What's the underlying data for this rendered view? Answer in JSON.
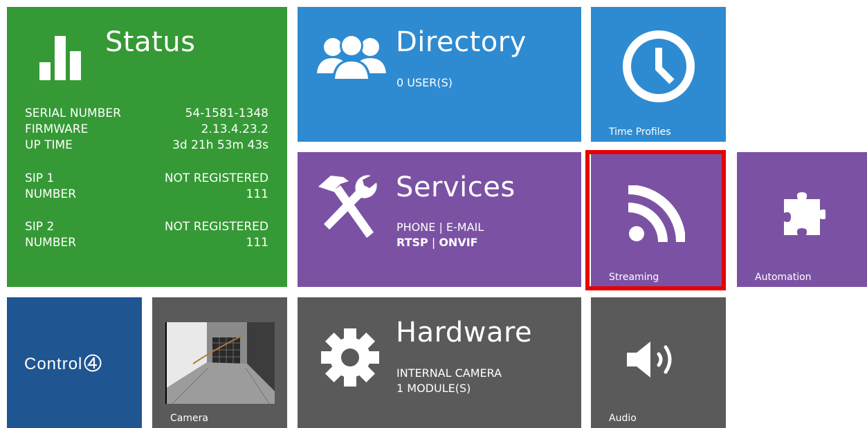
{
  "status": {
    "title": "Status",
    "rows1": [
      {
        "label": "SERIAL NUMBER",
        "value": "54-1581-1348"
      },
      {
        "label": "FIRMWARE",
        "value": "2.13.4.23.2"
      },
      {
        "label": "UP TIME",
        "value": "3d 21h 53m 43s"
      }
    ],
    "sip1": {
      "label1": "SIP 1",
      "value1": "NOT REGISTERED",
      "label2": "NUMBER",
      "value2": "111"
    },
    "sip2": {
      "label1": "SIP 2",
      "value1": "NOT REGISTERED",
      "label2": "NUMBER",
      "value2": "111"
    },
    "icon": "bar-chart-icon",
    "color": "#359a35"
  },
  "directory": {
    "title": "Directory",
    "subtitle": "0 USER(S)",
    "icon": "users-icon",
    "color": "#2e8bd1"
  },
  "time_profiles": {
    "label": "Time Profiles",
    "icon": "clock-icon"
  },
  "services": {
    "title": "Services",
    "line1": "PHONE | E-MAIL",
    "rtsp": "RTSP",
    "sep": " | ",
    "onvif": "ONVIF",
    "icon": "tools-icon",
    "color": "#7b52a3"
  },
  "streaming": {
    "label": "Streaming",
    "icon": "rss-icon",
    "highlight_color": "#e60000"
  },
  "automation": {
    "label": "Automation",
    "icon": "puzzle-icon"
  },
  "control4": {
    "text": "Control",
    "icon": "control4-logo"
  },
  "camera": {
    "label": "Camera",
    "icon": "camera-preview"
  },
  "hardware": {
    "title": "Hardware",
    "line1": "INTERNAL CAMERA",
    "line2": "1 MODULE(S)",
    "icon": "gear-icon",
    "color": "#5a5a5a"
  },
  "audio": {
    "label": "Audio",
    "icon": "speaker-icon"
  }
}
